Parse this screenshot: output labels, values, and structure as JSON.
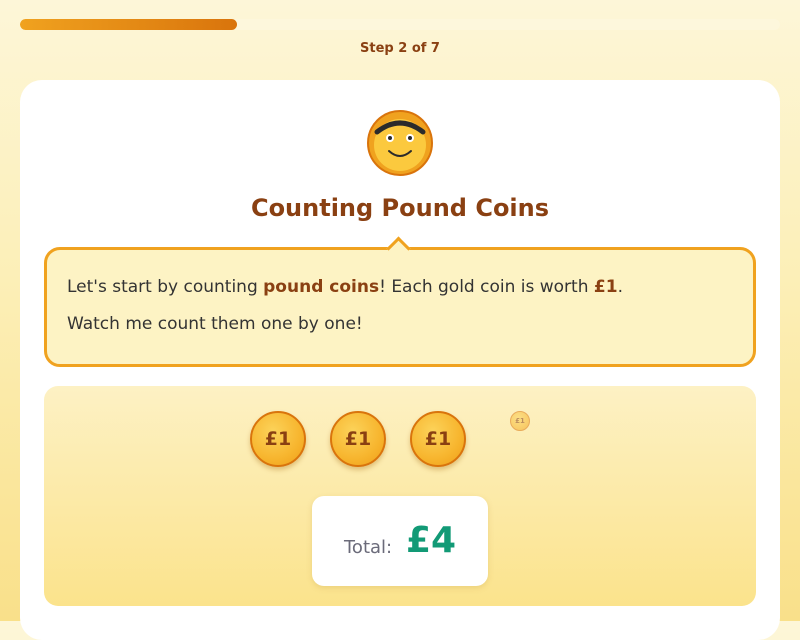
{
  "progress": {
    "label": "Step 2 of 7",
    "current_step": 2,
    "total_steps": 7,
    "fill_fraction": 0.286
  },
  "lesson": {
    "title": "Counting Pound Coins",
    "mascot_icon": "smiling-coin-mascot-icon"
  },
  "speech": {
    "line1_part1": "Let's start by counting ",
    "line1_highlight1": "pound coins",
    "line1_part2": "! Each gold coin is worth ",
    "line1_highlight2": "£1",
    "line1_part3": ".",
    "line2": "Watch me count them one by one!"
  },
  "coins": [
    {
      "label": "£1"
    },
    {
      "label": "£1"
    },
    {
      "label": "£1"
    },
    {
      "label": "£1"
    }
  ],
  "total": {
    "label": "Total:",
    "value": "£4"
  },
  "colors": {
    "accent": "#f0a21f",
    "title": "#8a4012",
    "total_value": "#129a76"
  }
}
